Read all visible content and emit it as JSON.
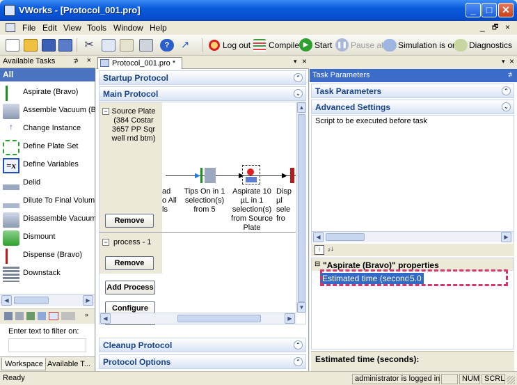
{
  "window": {
    "title": "VWorks - [Protocol_001.pro]"
  },
  "menu": {
    "items": [
      "File",
      "Edit",
      "View",
      "Tools",
      "Window",
      "Help"
    ]
  },
  "toolbar": {
    "log_out": "Log out",
    "compile": "Compile",
    "start": "Start",
    "pause_all": "Pause all",
    "simulation": "Simulation is on",
    "diagnostics": "Diagnostics"
  },
  "tasks_panel": {
    "title": "Available Tasks",
    "category": "All",
    "items": [
      "Aspirate (Bravo)",
      "Assemble Vacuum (B",
      "Change Instance",
      "Define Plate Set",
      "Define Variables",
      "Delid",
      "Dilute To Final Volum",
      "Disassemble Vacuum",
      "Dismount",
      "Dispense (Bravo)",
      "Downstack"
    ],
    "filter_label": "Enter text to filter on:",
    "filter_value": "",
    "tabs": [
      "Workspace",
      "Available T..."
    ]
  },
  "document": {
    "tab": "Protocol_001.pro *",
    "startup_section": "Startup Protocol",
    "main_section": "Main Protocol",
    "plate_name": "Source Plate (384 Costar 3657 PP Sqr well rnd btm)",
    "remove_label": "Remove",
    "process_label": "process - 1",
    "add_process": "Add Process",
    "configure_labware": "Configure Labware",
    "steps": [
      "ad\no All\nls",
      "Tips On in 1\nselection(s)\nfrom 5",
      "Aspirate 10\nµL in 1\nselection(s)\nfrom Source\nPlate",
      "Disp\nµl\nsele\nfro"
    ],
    "cleanup_section": "Cleanup Protocol",
    "options_section": "Protocol Options"
  },
  "task_params": {
    "pane_title": "Task Parameters",
    "section": "Task Parameters",
    "advanced": "Advanced Settings",
    "script_label": "Script to be executed before task",
    "properties_header": "\"Aspirate (Bravo)\" properties",
    "prop_name": "Estimated time (seconds):",
    "prop_value": "5.0",
    "desc_title": "Estimated time (seconds):"
  },
  "status": {
    "ready": "Ready",
    "user": "administrator is logged in",
    "num": "NUM",
    "scrl": "SCRL"
  },
  "colors": {
    "title_blue": "#0a5bdc",
    "section_text": "#15428b",
    "highlight_dash": "#d9336b",
    "selection": "#3169c6"
  }
}
